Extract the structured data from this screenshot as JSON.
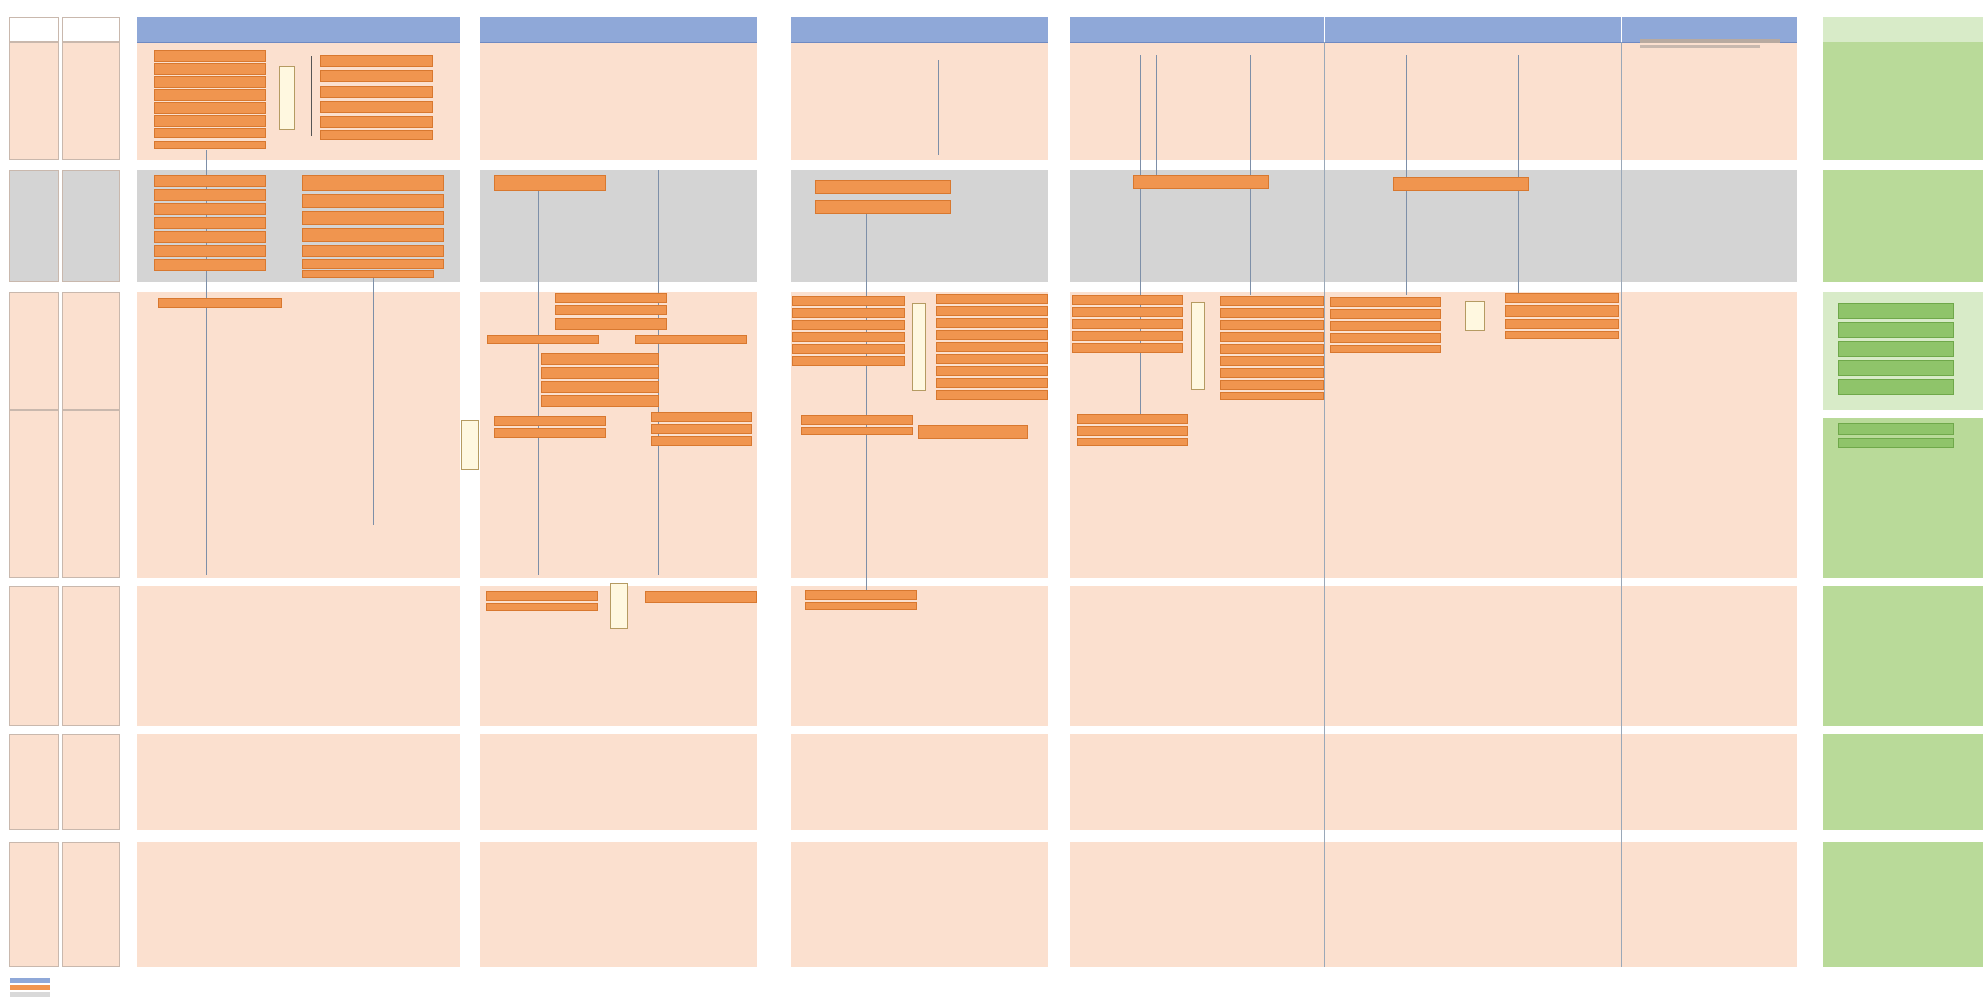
{
  "header": {
    "subtitle": "",
    "title": ""
  },
  "colors": {
    "lane_header": "#8fa8d8",
    "row_light": "#fbe0cf",
    "row_gray": "#d4d4d4",
    "task_box": "#f0954f",
    "result_panel": "#b9da99",
    "result_box": "#8fc46a"
  },
  "legend": [
    {
      "color": "#8fa8d8",
      "label": ""
    },
    {
      "color": "#f0954f",
      "label": ""
    },
    {
      "color": "#d9d9d9",
      "label": ""
    }
  ]
}
